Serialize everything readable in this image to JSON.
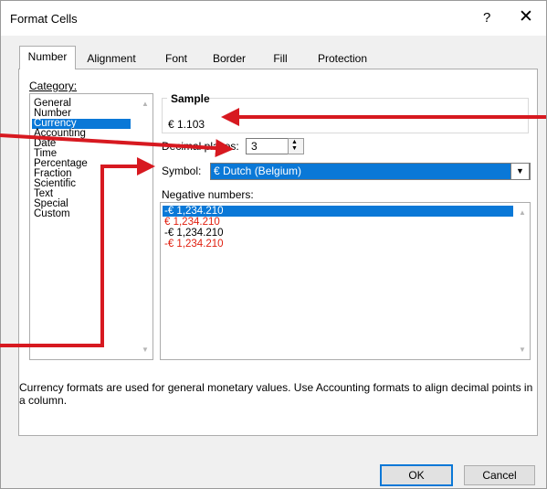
{
  "dialog": {
    "title": "Format Cells",
    "help_label": "?",
    "close_label": "✕"
  },
  "tabs": [
    {
      "label": "Number",
      "active": true
    },
    {
      "label": "Alignment"
    },
    {
      "label": "Font"
    },
    {
      "label": "Border"
    },
    {
      "label": "Fill"
    },
    {
      "label": "Protection"
    }
  ],
  "category": {
    "label": "Category:",
    "items": [
      "General",
      "Number",
      "Currency",
      "Accounting",
      "Date",
      "Time",
      "Percentage",
      "Fraction",
      "Scientific",
      "Text",
      "Special",
      "Custom"
    ],
    "selected": "Currency"
  },
  "sample": {
    "label": "Sample",
    "value": "€ 1.103"
  },
  "decimal_places": {
    "label": "Decimal places:",
    "value": "3"
  },
  "symbol": {
    "label": "Symbol:",
    "value": "€ Dutch (Belgium)"
  },
  "negative_numbers": {
    "label": "Negative numbers:",
    "items": [
      {
        "text": "-€ 1,234.210",
        "color": "#000000",
        "selected": true
      },
      {
        "text": "€ 1,234.210",
        "color": "#e02010"
      },
      {
        "text": "-€ 1,234.210",
        "color": "#000000"
      },
      {
        "text": "-€ 1,234.210",
        "color": "#e02010"
      }
    ]
  },
  "description": "Currency formats are used for general monetary values.  Use Accounting formats to align decimal points in a column.",
  "buttons": {
    "ok": "OK",
    "cancel": "Cancel"
  },
  "annotation_color": "#d71920"
}
